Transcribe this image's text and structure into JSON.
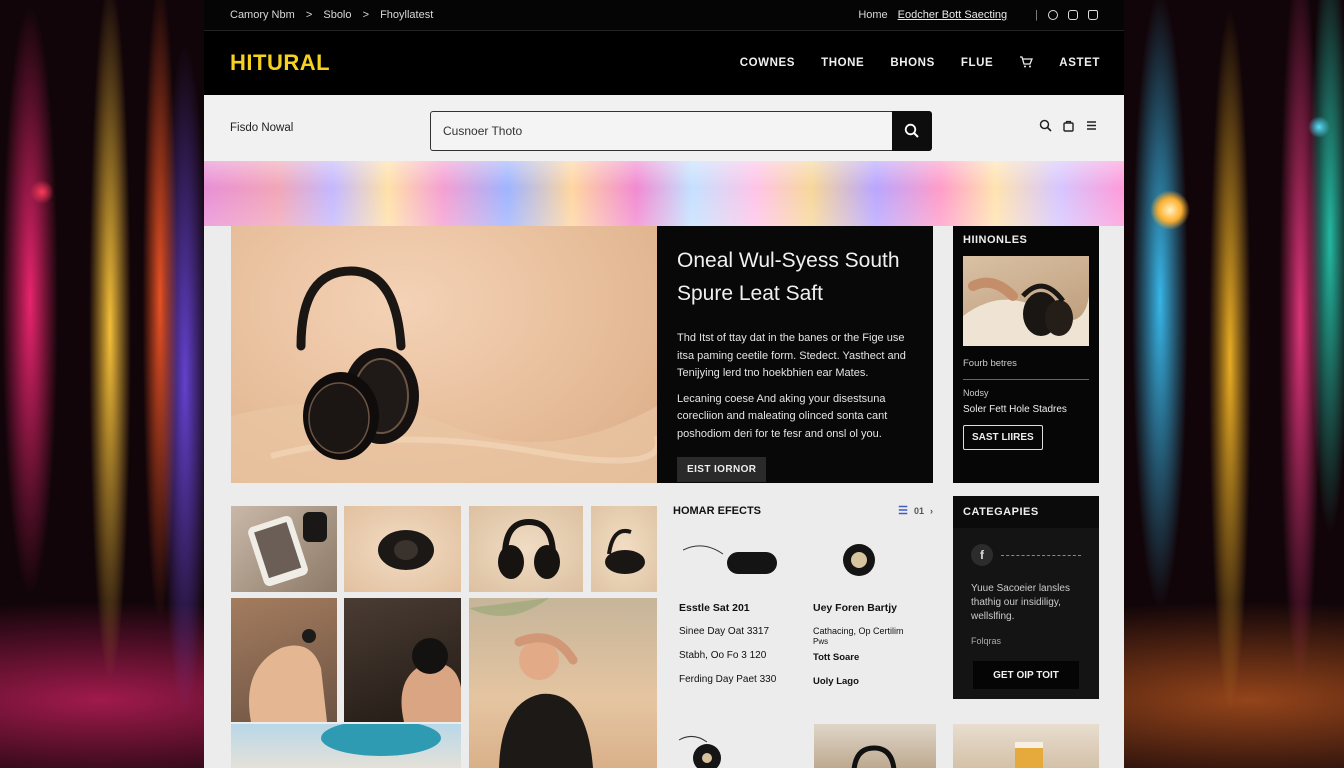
{
  "topbar": {
    "breadcrumb": [
      "Camory Nbm",
      ">",
      "Sbolo",
      ">",
      "Fhoyllatest"
    ],
    "right_home": "Home",
    "right_link": "Eodcher Bott Saecting"
  },
  "header": {
    "logo": "HITURAL",
    "nav": [
      "COWNES",
      "THONE",
      "BHONS",
      "FLUE",
      "ASTET"
    ]
  },
  "search": {
    "brand": "Fisdo Nowal",
    "value": "Cusnoer Thoto"
  },
  "hero": {
    "title": "Oneal Wul-Syess South Spure Leat Saft",
    "paragraph1": "Thd Itst of ttay dat in the banes or the Fige use itsa paming ceetile form. Stedect. Yasthect and Tenijying lerd tno hoekbhien ear Mates.",
    "paragraph2": "Lecaning coese And aking your disestsuna corecliion and maleating olinced sonta cant poshodiom deri for te fesr and onsl ol you.",
    "button": "EIST IORNOR"
  },
  "highlights": {
    "title": "HIINONLES",
    "caption": "Fourb betres",
    "label": "Nodsy",
    "name": "Soler Fett Hole Stadres",
    "button": "SAST LIIRES"
  },
  "effects": {
    "title": "HOMAR EFECTS",
    "pager": "01",
    "left": {
      "name": "Esstle Sat 201",
      "line1": "Sinee Day Oat 3317",
      "line2": "Stabh, Oo Fo 3 120",
      "line3": "Ferding Day Paet 330"
    },
    "right": {
      "name": "Uey Foren Bartjy",
      "line1": "Cathacing, Op Certilim",
      "line1b": "Pws",
      "line2": "Tott Soare",
      "line3": "Uoly Lago"
    }
  },
  "categories": {
    "title": "CATEGAPIES",
    "body": "Yuue Sacoeier lansles thathig our insidiligy, wellslfing.",
    "foot": "Folqras",
    "button": "GET OIP TOIT",
    "icon_letter": "f"
  },
  "colors": {
    "accent": "#f4d21e",
    "dark": "#080808",
    "panel": "#ececec"
  }
}
